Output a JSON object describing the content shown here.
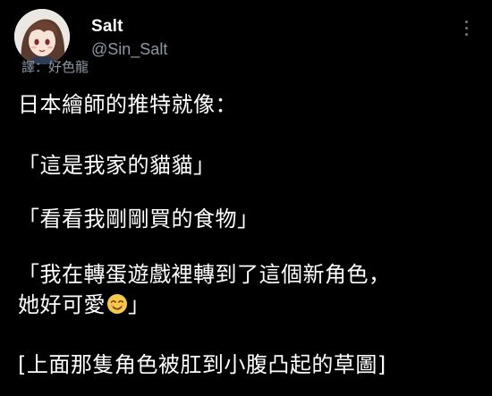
{
  "author": {
    "display_name": "Salt",
    "handle": "@Sin_Salt"
  },
  "translator_credit": "譯：好色龍",
  "tweet": {
    "line1": "日本繪師的推特就像：",
    "line2": "「這是我家的貓貓」",
    "line3": "「看看我剛剛買的食物」",
    "line4": "「我在轉蛋遊戲裡轉到了這個新角色，",
    "line5_text": "她好可愛",
    "line5_emoji": "smiling-face-icon",
    "line5_end": "」",
    "line6": "[上面那隻角色被肛到小腹凸起的草圖]"
  },
  "colors": {
    "background": "#000000",
    "text": "#ffffff",
    "secondary": "#8b98a5"
  },
  "icons": {
    "more": "more-dots-icon",
    "avatar": "avatar"
  }
}
